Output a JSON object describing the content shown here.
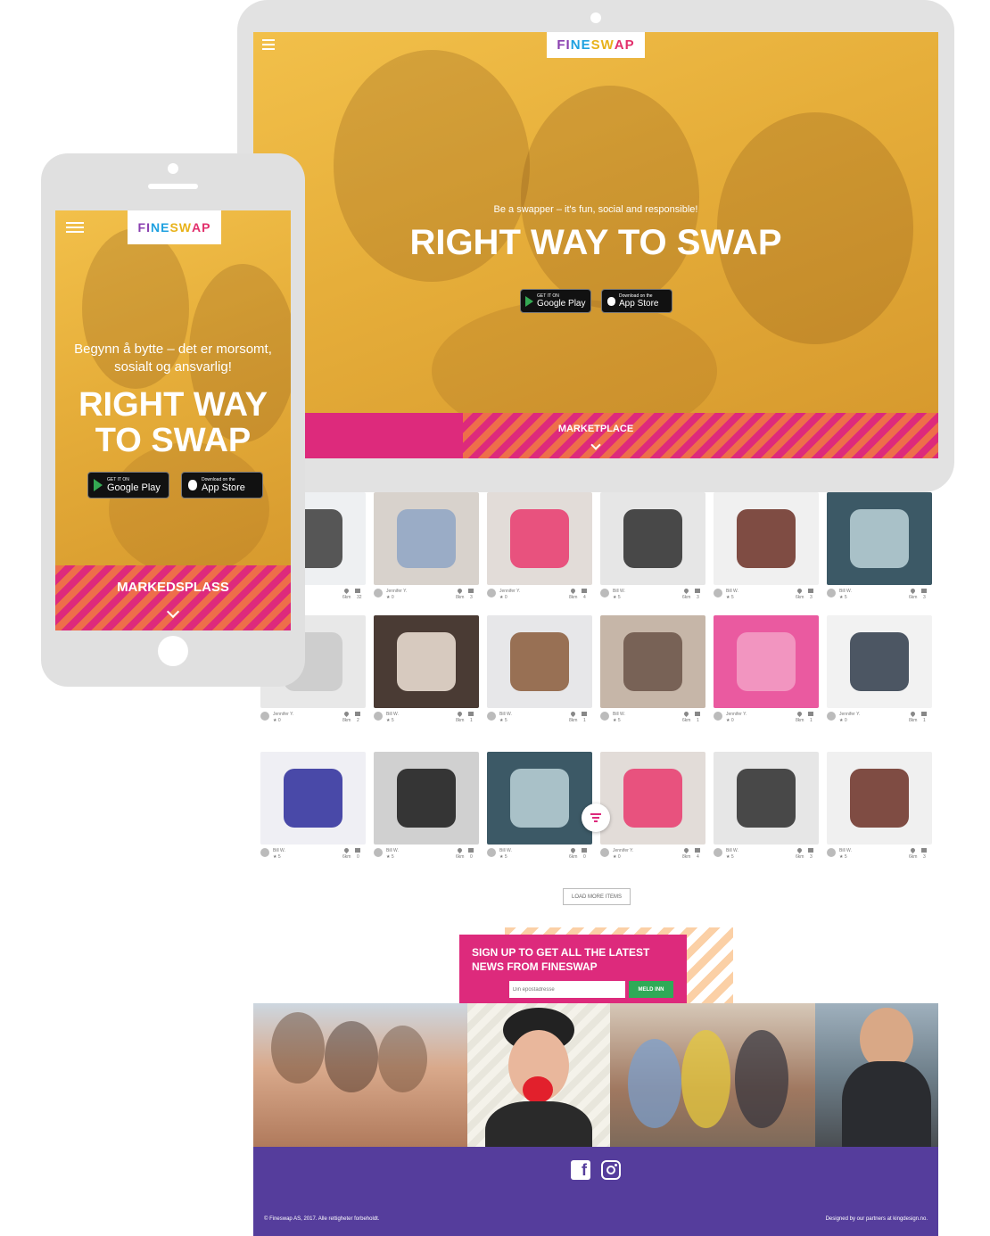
{
  "brand": {
    "logo_parts": [
      "FI",
      "NE",
      "SW",
      "AP"
    ],
    "colors": {
      "pink": "#dd2a7c",
      "orange": "#ee6e4a",
      "yellow": "#f2c04a",
      "purple": "#553d9c",
      "green": "#2faa57"
    }
  },
  "tablet": {
    "hero_subtitle": "Be a swapper – it's fun, social and responsible!",
    "hero_title": "RIGHT WAY TO SWAP",
    "google_small": "GET IT ON",
    "google_big": "Google Play",
    "apple_small": "Download on the",
    "apple_big": "App Store",
    "marketplace_label": "MARKETPLACE"
  },
  "phone": {
    "hero_subtitle": "Begynn å bytte – det er morsomt, sosialt og ansvarlig!",
    "hero_title": "RIGHT WAY TO SWAP",
    "google_small": "GET IT ON",
    "google_big": "Google Play",
    "apple_small": "Download on the",
    "apple_big": "App Store",
    "marketplace_label": "MARKEDSPLASS"
  },
  "grid": {
    "items": [
      {
        "user": "",
        "rating": "",
        "dist": "6km",
        "likes": "32",
        "icon": "hand-grip"
      },
      {
        "user": "Jennifer Y.",
        "rating": "0",
        "dist": "8km",
        "likes": "3",
        "icon": "baby-bodysuit"
      },
      {
        "user": "Jennifer Y.",
        "rating": "0",
        "dist": "8km",
        "likes": "4",
        "icon": "pink-tshirt"
      },
      {
        "user": "Bill W.",
        "rating": "5",
        "dist": "6km",
        "likes": "3",
        "icon": "checkered-bag"
      },
      {
        "user": "Bill W.",
        "rating": "5",
        "dist": "6km",
        "likes": "3",
        "icon": "leather-purse"
      },
      {
        "user": "Bill W.",
        "rating": "5",
        "dist": "6km",
        "likes": "3",
        "icon": "book"
      },
      {
        "user": "Jennifer Y.",
        "rating": "0",
        "dist": "8km",
        "likes": "2",
        "icon": "crib"
      },
      {
        "user": "Bill W.",
        "rating": "5",
        "dist": "8km",
        "likes": "1",
        "icon": "selfie"
      },
      {
        "user": "Bill W.",
        "rating": "5",
        "dist": "8km",
        "likes": "1",
        "icon": "coffee-cup"
      },
      {
        "user": "Bill W.",
        "rating": "5",
        "dist": "6km",
        "likes": "1",
        "icon": "people-room"
      },
      {
        "user": "Jennifer Y.",
        "rating": "0",
        "dist": "8km",
        "likes": "1",
        "icon": "pink-scarf"
      },
      {
        "user": "Jennifer Y.",
        "rating": "0",
        "dist": "8km",
        "likes": "1",
        "icon": "socks"
      },
      {
        "user": "Bill W.",
        "rating": "5",
        "dist": "6km",
        "likes": "0",
        "icon": "headphones"
      },
      {
        "user": "Bill W.",
        "rating": "5",
        "dist": "6km",
        "likes": "0",
        "icon": "cable"
      },
      {
        "user": "Bill W.",
        "rating": "5",
        "dist": "6km",
        "likes": "0",
        "icon": "book"
      },
      {
        "user": "Jennifer Y.",
        "rating": "0",
        "dist": "8km",
        "likes": "4",
        "icon": "pink-tshirt"
      },
      {
        "user": "Bill W.",
        "rating": "5",
        "dist": "6km",
        "likes": "3",
        "icon": "checkered-bag"
      },
      {
        "user": "Bill W.",
        "rating": "5",
        "dist": "6km",
        "likes": "3",
        "icon": "leather-purse"
      }
    ],
    "load_more": "LOAD MORE ITEMS"
  },
  "signup": {
    "title": "SIGN UP TO GET ALL THE LATEST NEWS FROM FINESWAP",
    "placeholder": "Din epostadresse",
    "button": "MELD INN"
  },
  "footer": {
    "copyright": "© Fineswap AS, 2017. Alle rettigheter forbeholdt.",
    "credit": "Designed by our partners at kingdesign.no."
  }
}
